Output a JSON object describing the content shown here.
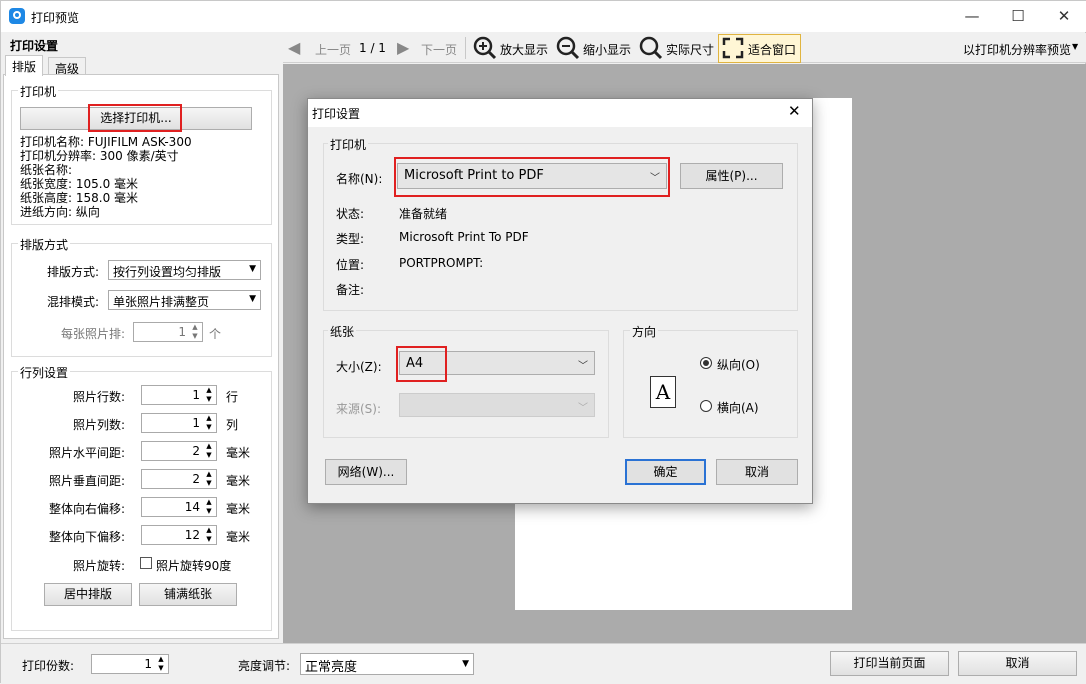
{
  "window": {
    "title": "打印预览",
    "minimize": "—",
    "maximize": "☐",
    "close": "✕"
  },
  "left_panel": {
    "title": "打印设置",
    "tabs": [
      {
        "label": "排版"
      },
      {
        "label": "高级"
      }
    ],
    "printer_group": {
      "label": "打印机",
      "select_button": "选择打印机...",
      "info": [
        "打印机名称: FUJIFILM ASK-300",
        "打印机分辨率: 300 像素/英寸",
        "纸张名称:",
        "纸张宽度: 105.0 毫米",
        "纸张高度: 158.0 毫米",
        "进纸方向: 纵向"
      ]
    },
    "layout_group": {
      "label": "排版方式",
      "layout_label": "排版方式:",
      "layout_value": "按行列设置均匀排版",
      "mix_label": "混排模式:",
      "mix_value": "单张照片排满整页",
      "per_label": "每张照片排:",
      "per_value": "1",
      "per_unit": "个"
    },
    "grid_group": {
      "label": "行列设置",
      "rows": [
        {
          "label": "照片行数:",
          "value": "1",
          "unit": "行"
        },
        {
          "label": "照片列数:",
          "value": "1",
          "unit": "列"
        },
        {
          "label": "照片水平间距:",
          "value": "2",
          "unit": "毫米"
        },
        {
          "label": "照片垂直间距:",
          "value": "2",
          "unit": "毫米"
        },
        {
          "label": "整体向右偏移:",
          "value": "14",
          "unit": "毫米"
        },
        {
          "label": "整体向下偏移:",
          "value": "12",
          "unit": "毫米"
        }
      ],
      "rotate_label": "照片旋转:",
      "rotate_checkbox": "照片旋转90度",
      "center_button": "居中排版",
      "fill_button": "铺满纸张"
    }
  },
  "toolbar": {
    "prev": "上一页",
    "page": "1 / 1",
    "next": "下一页",
    "zoom_in": "放大显示",
    "zoom_out": "缩小显示",
    "actual": "实际尺寸",
    "fit": "适合窗口",
    "mode": "以打印机分辨率预览"
  },
  "bottom": {
    "copies_label": "打印份数:",
    "copies_value": "1",
    "brightness_label": "亮度调节:",
    "brightness_value": "正常亮度",
    "print_button": "打印当前页面",
    "cancel_button": "取消"
  },
  "dialog": {
    "title": "打印设置",
    "printer_group": "打印机",
    "name_label": "名称(N):",
    "name_value": "Microsoft Print to PDF",
    "properties_button": "属性(P)...",
    "status_label": "状态:",
    "status_value": "准备就绪",
    "type_label": "类型:",
    "type_value": "Microsoft Print To PDF",
    "where_label": "位置:",
    "where_value": "PORTPROMPT:",
    "comment_label": "备注:",
    "paper_group": "纸张",
    "size_label": "大小(Z):",
    "size_value": "A4",
    "source_label": "来源(S):",
    "orientation_group": "方向",
    "portrait": "纵向(O)",
    "landscape": "横向(A)",
    "network_button": "网络(W)...",
    "ok_button": "确定",
    "cancel_button": "取消"
  }
}
